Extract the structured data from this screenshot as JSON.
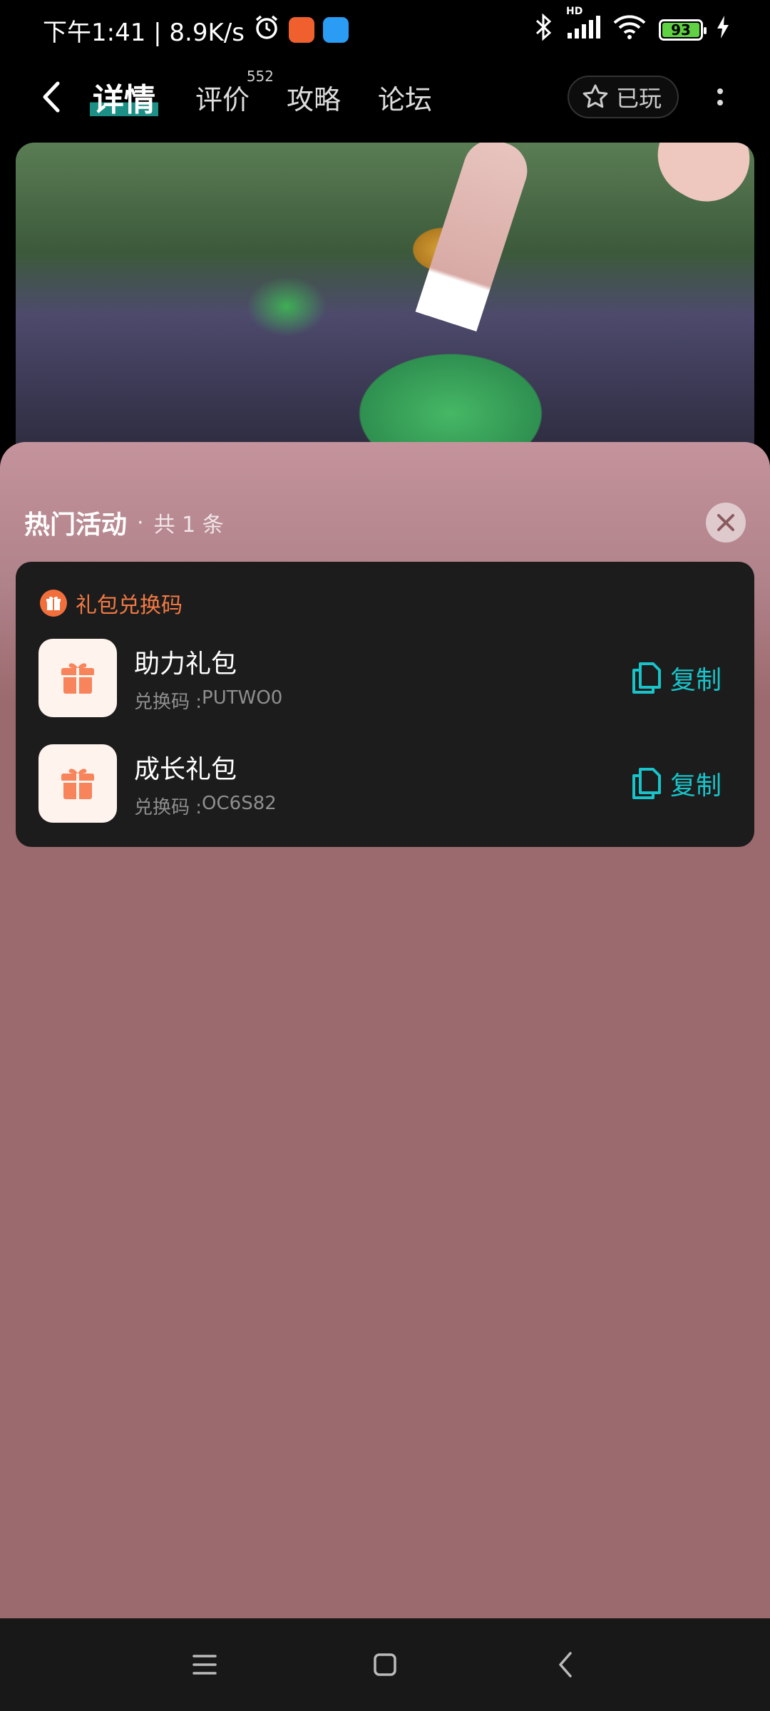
{
  "status_bar": {
    "time_speed": "下午1:41 | 8.9K/s",
    "network_label": "HD",
    "battery": "93"
  },
  "nav": {
    "tabs": [
      {
        "label": "详情"
      },
      {
        "label": "评价",
        "count": "552"
      },
      {
        "label": "攻略"
      },
      {
        "label": "论坛"
      }
    ],
    "played_label": "已玩"
  },
  "sheet": {
    "title": "热门活动",
    "separator": "·",
    "count_text": "共 1 条",
    "section_title": "礼包兑换码",
    "gifts": [
      {
        "name": "助力礼包",
        "code_label": "兑换码 : ",
        "code": "PUTWO0",
        "copy_label": "复制"
      },
      {
        "name": "成长礼包",
        "code_label": "兑换码 : ",
        "code": "OC6S82",
        "copy_label": "复制"
      }
    ]
  },
  "colors": {
    "accent_teal": "#19c3c9",
    "accent_orange": "#f27a44",
    "sheet_bg": "#9b6a6e",
    "card_bg": "#1c1c1c"
  },
  "icons": {
    "back": "back-arrow-icon",
    "star": "star-icon",
    "more": "more-vertical-icon",
    "close": "close-icon",
    "gift": "gift-icon",
    "copy": "copy-icon",
    "menu": "menu-icon",
    "home": "home-icon"
  }
}
